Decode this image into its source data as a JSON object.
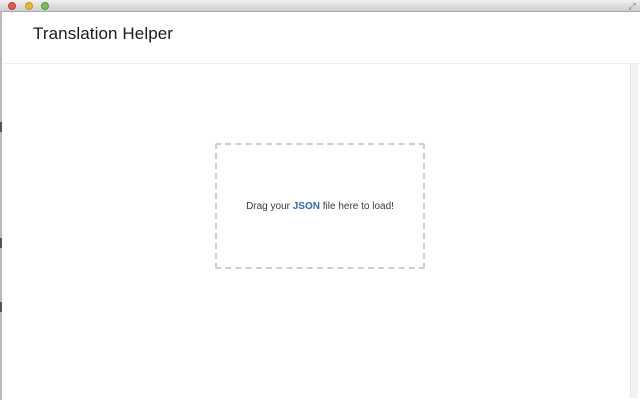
{
  "window": {
    "controls": [
      "close",
      "minimize",
      "zoom"
    ],
    "resize_icon": "fullscreen-arrows-icon"
  },
  "app": {
    "title": "Translation Helper"
  },
  "drop_zone": {
    "text_before": "Drag your ",
    "keyword": "JSON",
    "text_after": " file here to load!",
    "keyword_color": "#2f6db5",
    "border_color": "#cdcdcd"
  }
}
